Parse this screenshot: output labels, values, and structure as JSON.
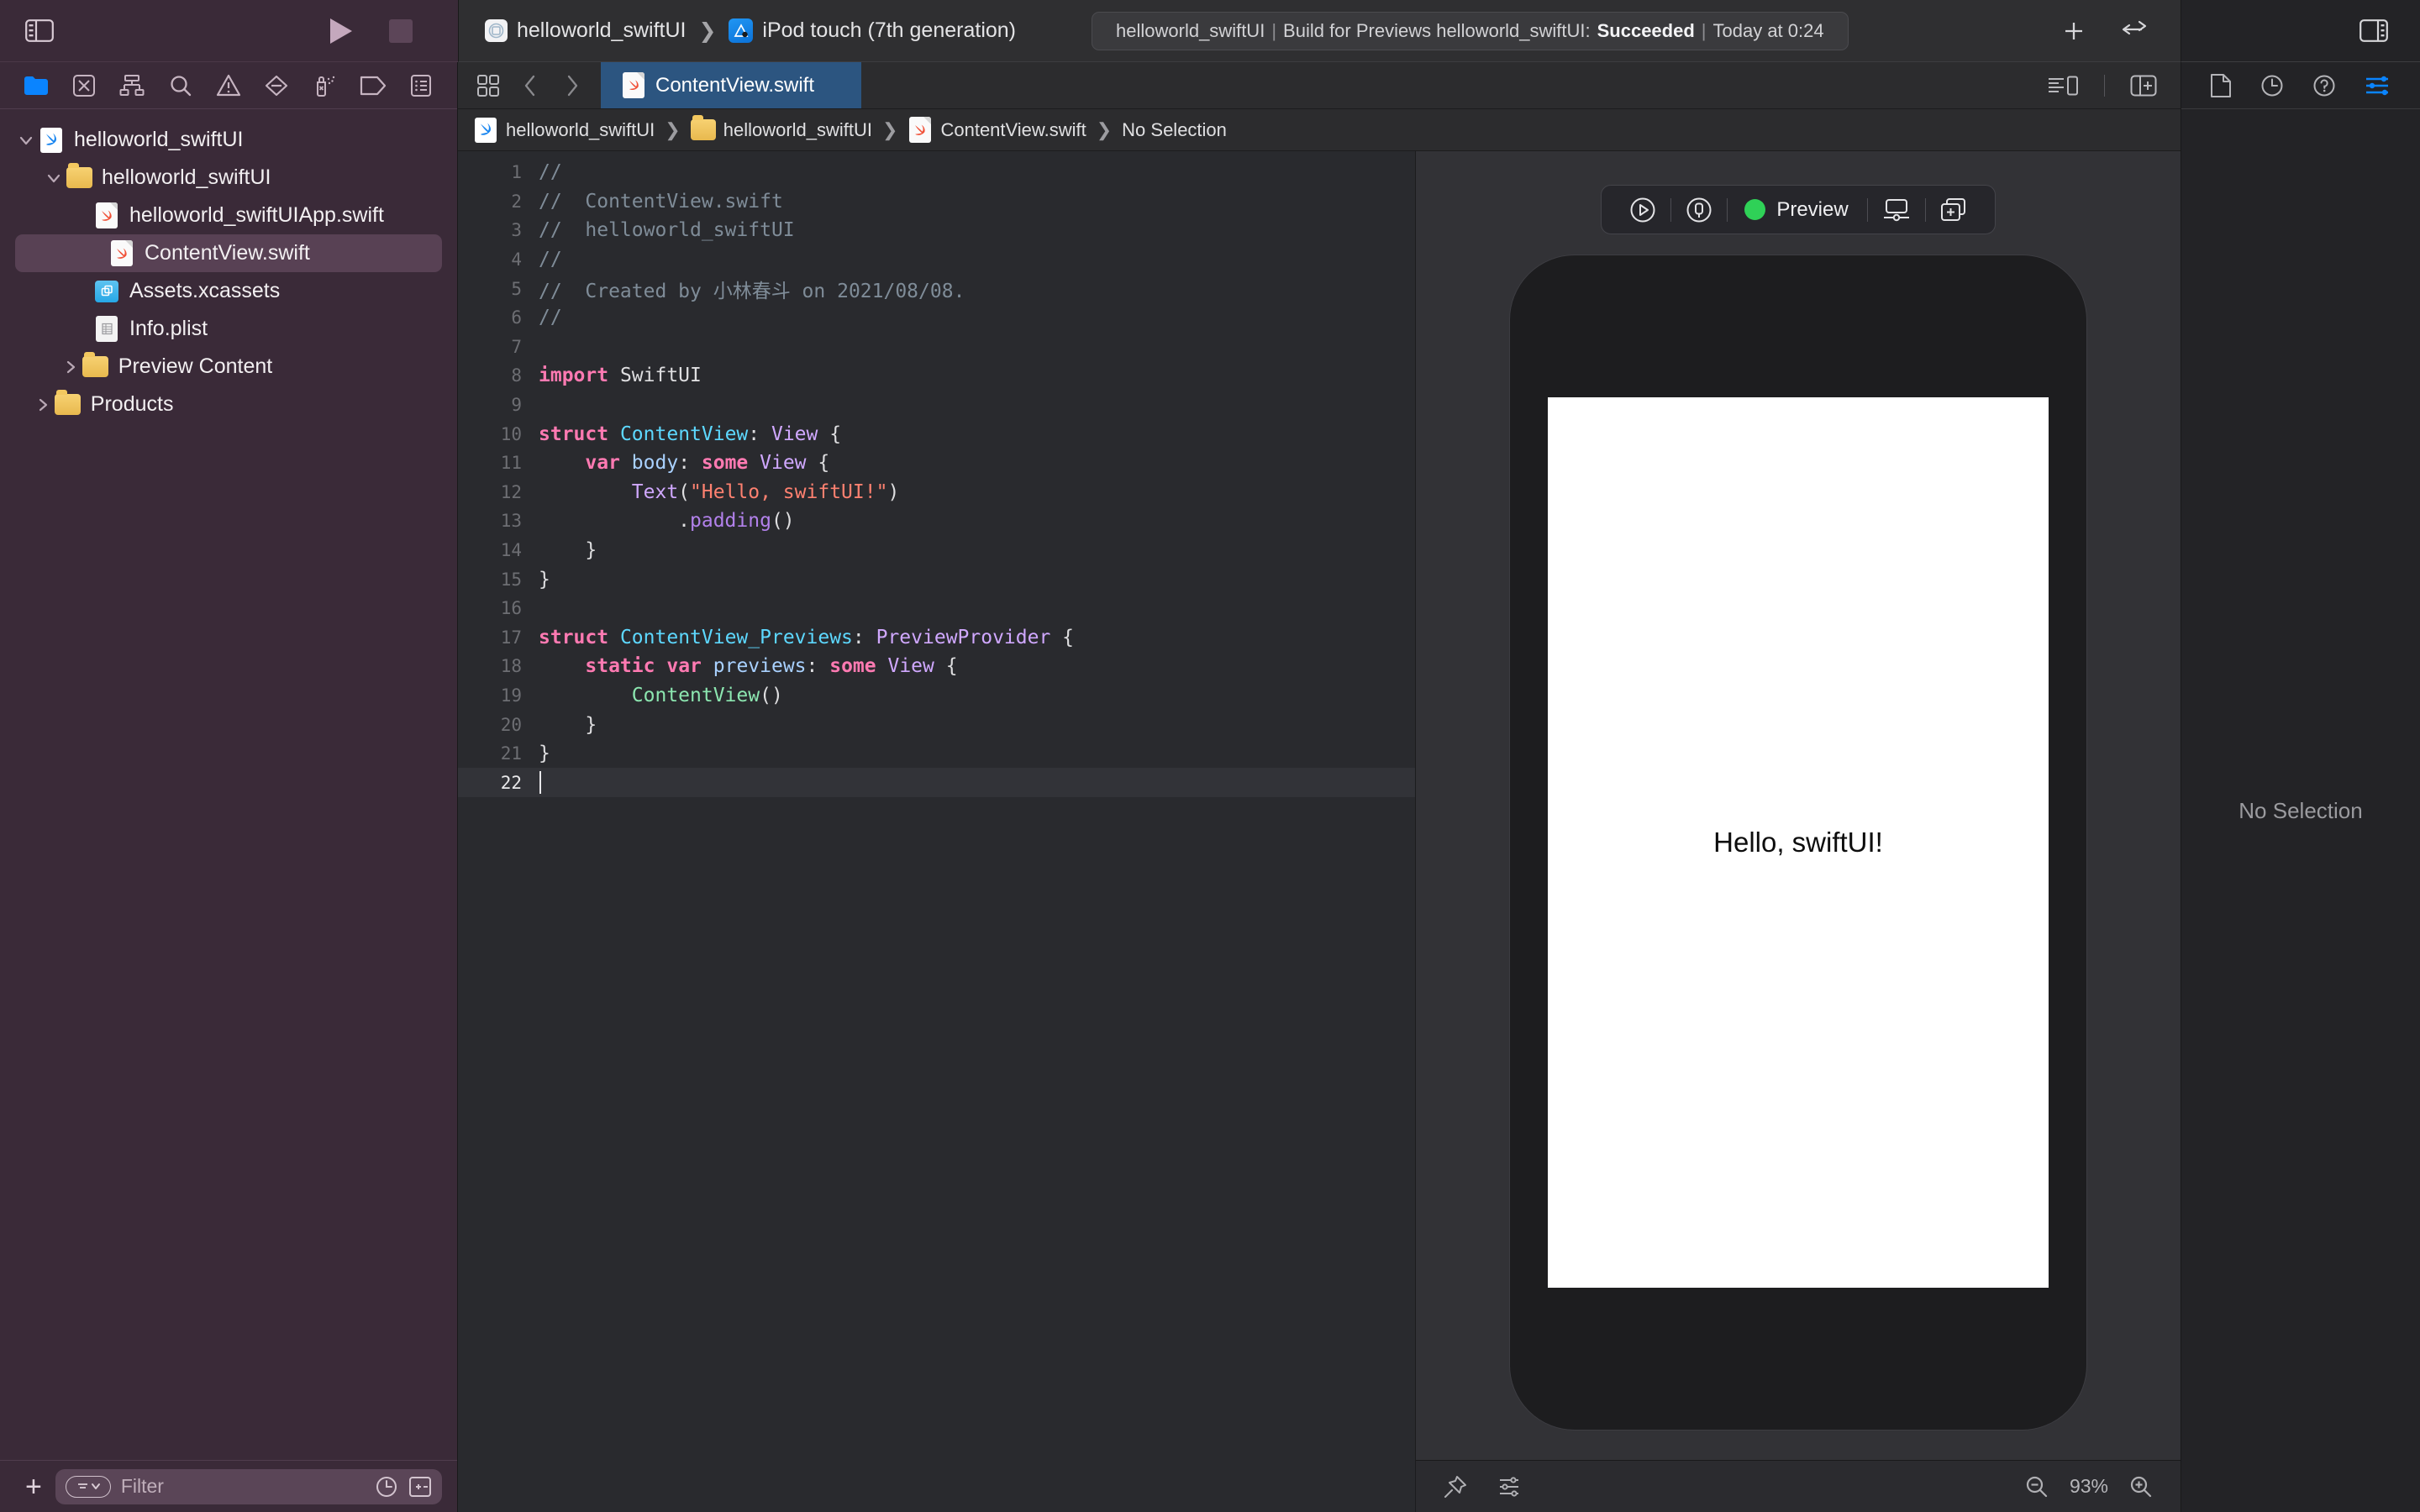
{
  "toolbar": {
    "sidebar_toggle": "toggle-navigator",
    "run_button": "Run",
    "stop_button": "Stop",
    "scheme_project": "helloworld_swiftUI",
    "scheme_separator": "❯",
    "scheme_destination": "iPod touch (7th generation)",
    "status": {
      "project": "helloworld_swiftUI",
      "pipe": "|",
      "action": "Build for Previews helloworld_swiftUI:",
      "result": "Succeeded",
      "time": "Today at 0:24"
    },
    "add_button": "+",
    "library_button": "toggle-library",
    "inspector_toggle": "toggle-inspector"
  },
  "navigator": {
    "tabs": [
      {
        "name": "project-navigator",
        "label": "Project",
        "active": true
      },
      {
        "name": "source-control-navigator",
        "label": "Source Control",
        "active": false
      },
      {
        "name": "symbol-navigator",
        "label": "Symbols",
        "active": false
      },
      {
        "name": "find-navigator",
        "label": "Find",
        "active": false
      },
      {
        "name": "issue-navigator",
        "label": "Issues",
        "active": false
      },
      {
        "name": "test-navigator",
        "label": "Tests",
        "active": false
      },
      {
        "name": "debug-navigator",
        "label": "Debug",
        "active": false
      },
      {
        "name": "breakpoint-navigator",
        "label": "Breakpoints",
        "active": false
      },
      {
        "name": "report-navigator",
        "label": "Reports",
        "active": false
      }
    ],
    "tree": [
      {
        "label": "helloworld_swiftUI",
        "icon": "xcodeproj-icon",
        "depth": 0,
        "twisty": "open",
        "selected": false
      },
      {
        "label": "helloworld_swiftUI",
        "icon": "folder-icon",
        "depth": 1,
        "twisty": "open",
        "selected": false
      },
      {
        "label": "helloworld_swiftUIApp.swift",
        "icon": "swift-file-icon",
        "depth": 2,
        "twisty": "none",
        "selected": false
      },
      {
        "label": "ContentView.swift",
        "icon": "swift-file-icon",
        "depth": 2,
        "twisty": "none",
        "selected": true
      },
      {
        "label": "Assets.xcassets",
        "icon": "assets-icon",
        "depth": 2,
        "twisty": "none",
        "selected": false
      },
      {
        "label": "Info.plist",
        "icon": "plist-icon",
        "depth": 2,
        "twisty": "none",
        "selected": false
      },
      {
        "label": "Preview Content",
        "icon": "folder-icon",
        "depth": 1.6,
        "twisty": "closed",
        "selected": false
      },
      {
        "label": "Products",
        "icon": "folder-icon",
        "depth": 0.6,
        "twisty": "closed",
        "selected": false
      }
    ],
    "filter": {
      "add_label": "+",
      "placeholder": "Filter",
      "recent_icon": "clock-icon",
      "sourcecontrol_icon": "plus-minus-icon"
    }
  },
  "editor": {
    "grid_button": "editor-options",
    "back_button": "‹",
    "forward_button": "›",
    "tab": {
      "label": "ContentView.swift",
      "icon": "swift-file-icon",
      "active": true
    },
    "canvas_toggle": "toggle-canvas",
    "add_editor": "add-editor",
    "breadcrumb": [
      {
        "label": "helloworld_swiftUI",
        "icon": "xcodeproj-icon"
      },
      {
        "label": "helloworld_swiftUI",
        "icon": "folder-icon"
      },
      {
        "label": "ContentView.swift",
        "icon": "swift-file-icon"
      },
      {
        "label": "No Selection",
        "icon": "none"
      }
    ],
    "breadcrumb_separator": "❯",
    "current_line": 22,
    "code_lines": [
      {
        "n": 1,
        "tokens": [
          {
            "t": "//",
            "c": "cm"
          }
        ]
      },
      {
        "n": 2,
        "tokens": [
          {
            "t": "//  ContentView.swift",
            "c": "cm"
          }
        ]
      },
      {
        "n": 3,
        "tokens": [
          {
            "t": "//  helloworld_swiftUI",
            "c": "cm"
          }
        ]
      },
      {
        "n": 4,
        "tokens": [
          {
            "t": "//",
            "c": "cm"
          }
        ]
      },
      {
        "n": 5,
        "tokens": [
          {
            "t": "//  Created by 小林春斗 on 2021/08/08.",
            "c": "cm"
          }
        ]
      },
      {
        "n": 6,
        "tokens": [
          {
            "t": "//",
            "c": "cm"
          }
        ]
      },
      {
        "n": 7,
        "tokens": []
      },
      {
        "n": 8,
        "tokens": [
          {
            "t": "import",
            "c": "kw"
          },
          {
            "t": " SwiftUI",
            "c": ""
          }
        ]
      },
      {
        "n": 9,
        "tokens": []
      },
      {
        "n": 10,
        "tokens": [
          {
            "t": "struct",
            "c": "kw"
          },
          {
            "t": " ",
            "c": ""
          },
          {
            "t": "ContentView",
            "c": "ty"
          },
          {
            "t": ": ",
            "c": ""
          },
          {
            "t": "View",
            "c": "ty2"
          },
          {
            "t": " {",
            "c": ""
          }
        ]
      },
      {
        "n": 11,
        "tokens": [
          {
            "t": "    ",
            "c": ""
          },
          {
            "t": "var",
            "c": "kw"
          },
          {
            "t": " ",
            "c": ""
          },
          {
            "t": "body",
            "c": "vr"
          },
          {
            "t": ": ",
            "c": ""
          },
          {
            "t": "some",
            "c": "kw"
          },
          {
            "t": " ",
            "c": ""
          },
          {
            "t": "View",
            "c": "ty2"
          },
          {
            "t": " {",
            "c": ""
          }
        ]
      },
      {
        "n": 12,
        "tokens": [
          {
            "t": "        ",
            "c": ""
          },
          {
            "t": "Text",
            "c": "ty2"
          },
          {
            "t": "(",
            "c": ""
          },
          {
            "t": "\"Hello, swiftUI!\"",
            "c": "st"
          },
          {
            "t": ")",
            "c": ""
          }
        ]
      },
      {
        "n": 13,
        "tokens": [
          {
            "t": "            .",
            "c": ""
          },
          {
            "t": "padding",
            "c": "mt"
          },
          {
            "t": "()",
            "c": ""
          }
        ]
      },
      {
        "n": 14,
        "tokens": [
          {
            "t": "    }",
            "c": ""
          }
        ]
      },
      {
        "n": 15,
        "tokens": [
          {
            "t": "}",
            "c": ""
          }
        ]
      },
      {
        "n": 16,
        "tokens": []
      },
      {
        "n": 17,
        "tokens": [
          {
            "t": "struct",
            "c": "kw"
          },
          {
            "t": " ",
            "c": ""
          },
          {
            "t": "ContentView_Previews",
            "c": "ty"
          },
          {
            "t": ": ",
            "c": ""
          },
          {
            "t": "PreviewProvider",
            "c": "ty2"
          },
          {
            "t": " {",
            "c": ""
          }
        ]
      },
      {
        "n": 18,
        "tokens": [
          {
            "t": "    ",
            "c": ""
          },
          {
            "t": "static",
            "c": "kw"
          },
          {
            "t": " ",
            "c": ""
          },
          {
            "t": "var",
            "c": "kw"
          },
          {
            "t": " ",
            "c": ""
          },
          {
            "t": "previews",
            "c": "vr"
          },
          {
            "t": ": ",
            "c": ""
          },
          {
            "t": "some",
            "c": "kw"
          },
          {
            "t": " ",
            "c": ""
          },
          {
            "t": "View",
            "c": "ty2"
          },
          {
            "t": " {",
            "c": ""
          }
        ]
      },
      {
        "n": 19,
        "tokens": [
          {
            "t": "        ",
            "c": ""
          },
          {
            "t": "ContentView",
            "c": "pr"
          },
          {
            "t": "()",
            "c": ""
          }
        ]
      },
      {
        "n": 20,
        "tokens": [
          {
            "t": "    }",
            "c": ""
          }
        ]
      },
      {
        "n": 21,
        "tokens": [
          {
            "t": "}",
            "c": ""
          }
        ]
      },
      {
        "n": 22,
        "tokens": []
      }
    ]
  },
  "canvas": {
    "toolbar": {
      "play_button": "play-preview",
      "inspect_button": "inspect-preview",
      "status_label": "Preview",
      "status_color": "#2fd157",
      "device_settings": "device-settings",
      "duplicate_preview": "duplicate-preview"
    },
    "preview_text": "Hello, swiftUI!",
    "bottom": {
      "pin_button": "pin-preview",
      "variants_button": "preview-variants",
      "zoom_out": "zoom-out",
      "zoom_level": "93%",
      "zoom_in": "zoom-in"
    }
  },
  "inspector": {
    "tabs": [
      {
        "name": "file-inspector",
        "label": "File",
        "active": false
      },
      {
        "name": "history-inspector",
        "label": "History",
        "active": false
      },
      {
        "name": "help-inspector",
        "label": "Quick Help",
        "active": false
      },
      {
        "name": "attributes-inspector",
        "label": "Attributes",
        "active": true
      }
    ],
    "empty_text": "No Selection",
    "accent_color": "#0a84ff"
  }
}
